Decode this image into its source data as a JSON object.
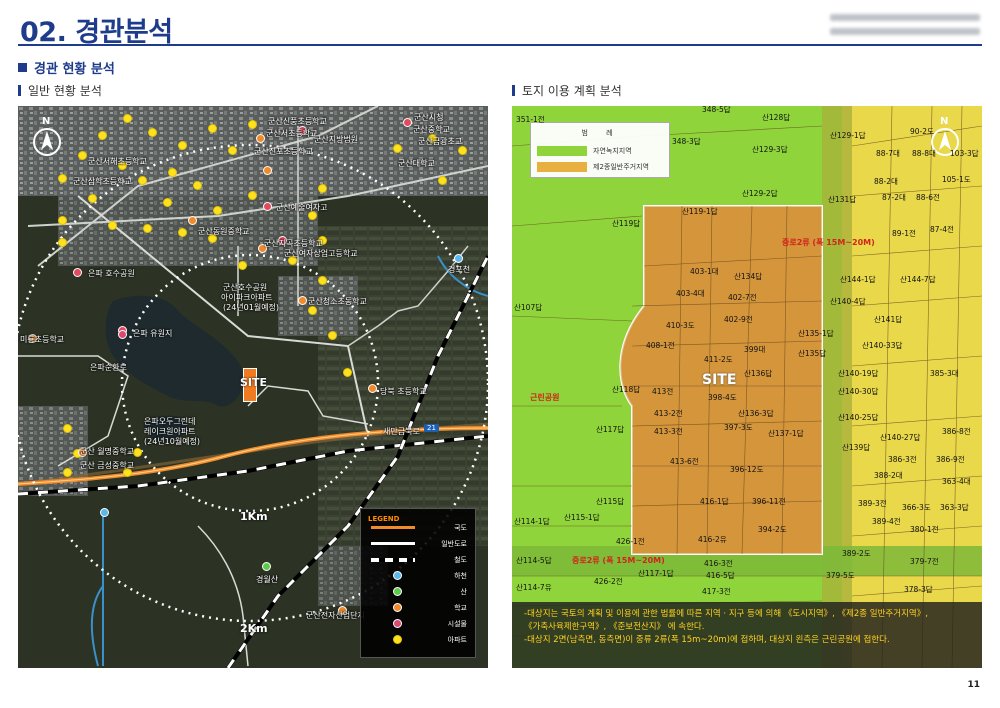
{
  "page": {
    "title": "02. 경관분석",
    "page_number": "11"
  },
  "section": {
    "title": "경관 현황 분석",
    "left_caption": "일반 현황 분석",
    "right_caption": "토지 이용 계획 분석"
  },
  "colors": {
    "accent": "#1f3c8c",
    "site": "#f07b21",
    "green_zone": "#8ed43a",
    "residential_zone": "#e8d84a",
    "note_text": "#ffd21f"
  },
  "satellite_map": {
    "north_label": "N",
    "site_label": "SITE",
    "distance_labels": [
      "1Km",
      "2Km"
    ],
    "road_label": "새만금북로",
    "road_number": "21",
    "places": [
      {
        "text": "군산신풍초등학교"
      },
      {
        "text": "군산서초등학교"
      },
      {
        "text": "군산지방법원"
      },
      {
        "text": "군산시청"
      },
      {
        "text": "군산진포초등학교"
      },
      {
        "text": "군산중학교"
      },
      {
        "text": "군산서해초등학교"
      },
      {
        "text": "군산예술여자고"
      },
      {
        "text": "군산금광초교"
      },
      {
        "text": "군산삼학초등학교"
      },
      {
        "text": "군산동원중학교"
      },
      {
        "text": "군산지곡초등학교"
      },
      {
        "text": "군산여자상업고등학교"
      },
      {
        "text": "군산호수공원"
      },
      {
        "text": "아이파크아파트"
      },
      {
        "text": "(24년01월예정)"
      },
      {
        "text": "군산청소초등학교"
      },
      {
        "text": "은파 호수공원"
      },
      {
        "text": "은파 유원지"
      },
      {
        "text": "은파순환로"
      },
      {
        "text": "미룡초등학교"
      },
      {
        "text": "은파오두그린데"
      },
      {
        "text": "레이크원아파트"
      },
      {
        "text": "(24년10월예정)"
      },
      {
        "text": "군산 월명중학교"
      },
      {
        "text": "군산 금성중학교"
      },
      {
        "text": "당북 초등학교"
      },
      {
        "text": "경포천"
      },
      {
        "text": "경월산"
      },
      {
        "text": "군산전자산업단지"
      },
      {
        "text": "군산대학교"
      }
    ],
    "legend": {
      "title": "LEGEND",
      "items": [
        {
          "label": "국도",
          "symbol": "orange-line"
        },
        {
          "label": "일반도로",
          "symbol": "white-line"
        },
        {
          "label": "철도",
          "symbol": "rail-line"
        },
        {
          "label": "하천",
          "symbol": "blue-dot"
        },
        {
          "label": "산",
          "symbol": "green-dot"
        },
        {
          "label": "학교",
          "symbol": "orange-dot"
        },
        {
          "label": "시설물",
          "symbol": "pink-dot"
        },
        {
          "label": "아파트",
          "symbol": "yellow-dot"
        }
      ]
    }
  },
  "landuse_map": {
    "north_label": "N",
    "site_label": "SITE",
    "legend": {
      "title": "범 례",
      "items": [
        {
          "label": "자연녹지지역",
          "color": "#8ed43a"
        },
        {
          "label": "제2종일반주거지역",
          "color": "#e8b040"
        }
      ]
    },
    "road_labels": [
      "중로2류 (폭 15M~20M)",
      "중로2류 (폭 15M~20M)"
    ],
    "park_label": "근린공원",
    "parcels": [
      {
        "text": "351-1전"
      },
      {
        "text": "348-5답"
      },
      {
        "text": "348-3답"
      },
      {
        "text": "산128답"
      },
      {
        "text": "산129-1답"
      },
      {
        "text": "산129-3답"
      },
      {
        "text": "산129-2답"
      },
      {
        "text": "산119-1답"
      },
      {
        "text": "산119답"
      },
      {
        "text": "산131답"
      },
      {
        "text": "403-1대"
      },
      {
        "text": "산134답"
      },
      {
        "text": "403-4대"
      },
      {
        "text": "402-7전"
      },
      {
        "text": "산107답"
      },
      {
        "text": "410-3도"
      },
      {
        "text": "402-9전"
      },
      {
        "text": "408-1전"
      },
      {
        "text": "산135-1답"
      },
      {
        "text": "399대"
      },
      {
        "text": "411-2도"
      },
      {
        "text": "산135답"
      },
      {
        "text": "산136답"
      },
      {
        "text": "413전"
      },
      {
        "text": "398-4도"
      },
      {
        "text": "산118답"
      },
      {
        "text": "413-2전"
      },
      {
        "text": "산136-3답"
      },
      {
        "text": "413-3전"
      },
      {
        "text": "397-3도"
      },
      {
        "text": "산137-1답"
      },
      {
        "text": "산117답"
      },
      {
        "text": "413-6전"
      },
      {
        "text": "396-12도"
      },
      {
        "text": "산115답"
      },
      {
        "text": "416-1답"
      },
      {
        "text": "396-11전"
      },
      {
        "text": "산114-1답"
      },
      {
        "text": "산115-1답"
      },
      {
        "text": "394-2도"
      },
      {
        "text": "426-1전"
      },
      {
        "text": "416-2유"
      },
      {
        "text": "산114-5답"
      },
      {
        "text": "416-3전"
      },
      {
        "text": "산117-1답"
      },
      {
        "text": "416-5답"
      },
      {
        "text": "426-2전"
      },
      {
        "text": "산114-7유"
      },
      {
        "text": "417-3전"
      },
      {
        "text": "90-2도"
      },
      {
        "text": "88-7대"
      },
      {
        "text": "88-8대"
      },
      {
        "text": "103-3답"
      },
      {
        "text": "105-1도"
      },
      {
        "text": "88-2대"
      },
      {
        "text": "88-6전"
      },
      {
        "text": "87-2대"
      },
      {
        "text": "87-4전"
      },
      {
        "text": "89-1전"
      },
      {
        "text": "산144-1답"
      },
      {
        "text": "산144-7답"
      },
      {
        "text": "산140-4답"
      },
      {
        "text": "산141답"
      },
      {
        "text": "산140-33답"
      },
      {
        "text": "산140-19답"
      },
      {
        "text": "385-3대"
      },
      {
        "text": "산140-30답"
      },
      {
        "text": "산140-25답"
      },
      {
        "text": "386-8전"
      },
      {
        "text": "산140-27답"
      },
      {
        "text": "산139답"
      },
      {
        "text": "386-3전"
      },
      {
        "text": "386-9전"
      },
      {
        "text": "388-2대"
      },
      {
        "text": "363-4대"
      },
      {
        "text": "389-3전"
      },
      {
        "text": "366-3도"
      },
      {
        "text": "363-3답"
      },
      {
        "text": "389-4전"
      },
      {
        "text": "380-1전"
      },
      {
        "text": "389-2도"
      },
      {
        "text": "379-7전"
      },
      {
        "text": "379-5도"
      },
      {
        "text": "378-3답"
      }
    ],
    "notes": [
      "-대상지는 국토의 계획 및 이용에 관한 법률에 따른 지역 · 지구 등에 의해 《도시지역》, 《제2종 일반주거지역》,",
      "  《가축사육제한구역》, 《준보전산지》 에 속한다.",
      "-대상지 2면(남측면, 동측면)이 중류 2류(폭 15m~20m)에 접하며, 대상지 왼측은 근린공원에 접한다."
    ]
  }
}
